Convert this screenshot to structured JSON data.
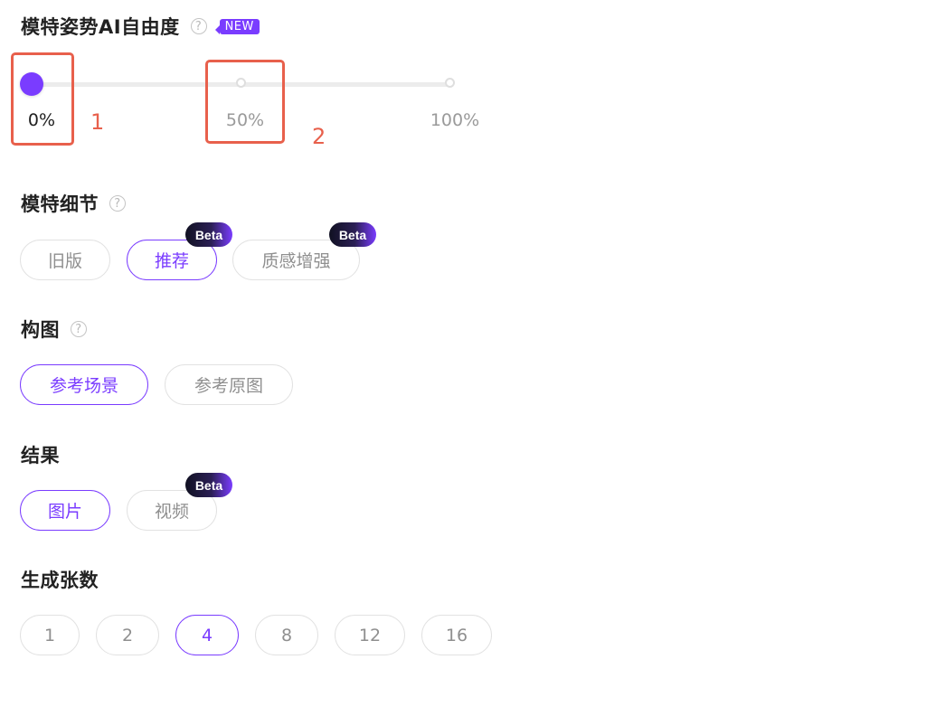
{
  "pose": {
    "title": "模特姿势AI自由度",
    "help": "?",
    "new_badge": "NEW",
    "labels": [
      "0%",
      "50%",
      "100%"
    ],
    "value_percent": 0
  },
  "annotations": [
    "1",
    "2"
  ],
  "detail": {
    "title": "模特细节",
    "help": "?",
    "options": [
      {
        "label": "旧版",
        "selected": false,
        "badge": ""
      },
      {
        "label": "推荐",
        "selected": true,
        "badge": "Beta"
      },
      {
        "label": "质感增强",
        "selected": false,
        "badge": "Beta"
      }
    ]
  },
  "composition": {
    "title": "构图",
    "help": "?",
    "options": [
      {
        "label": "参考场景",
        "selected": true
      },
      {
        "label": "参考原图",
        "selected": false
      }
    ]
  },
  "result": {
    "title": "结果",
    "options": [
      {
        "label": "图片",
        "selected": true,
        "badge": ""
      },
      {
        "label": "视频",
        "selected": false,
        "badge": "Beta"
      }
    ]
  },
  "count": {
    "title": "生成张数",
    "options": [
      "1",
      "2",
      "4",
      "8",
      "12",
      "16"
    ],
    "selected": "4"
  },
  "colors": {
    "accent": "#7a3cff",
    "annotation": "#e8604c"
  }
}
